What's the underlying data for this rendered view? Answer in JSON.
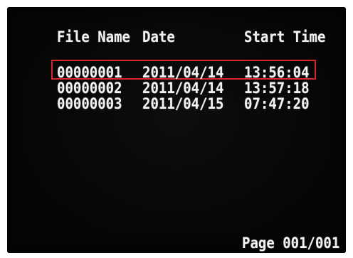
{
  "colors": {
    "screen_background": "#050505",
    "text": "#f2f2f2",
    "selection_border": "#d8262c"
  },
  "file_list": {
    "headers": {
      "file_name": "File Name",
      "date": "Date",
      "start_time": "Start Time"
    },
    "rows": [
      {
        "file_name": "00000001",
        "date": "2011/04/14",
        "start_time": "13:56:04",
        "selected": true
      },
      {
        "file_name": "00000002",
        "date": "2011/04/14",
        "start_time": "13:57:18",
        "selected": false
      },
      {
        "file_name": "00000003",
        "date": "2011/04/15",
        "start_time": "07:47:20",
        "selected": false
      }
    ]
  },
  "footer": {
    "page_label": "Page 001/001"
  }
}
